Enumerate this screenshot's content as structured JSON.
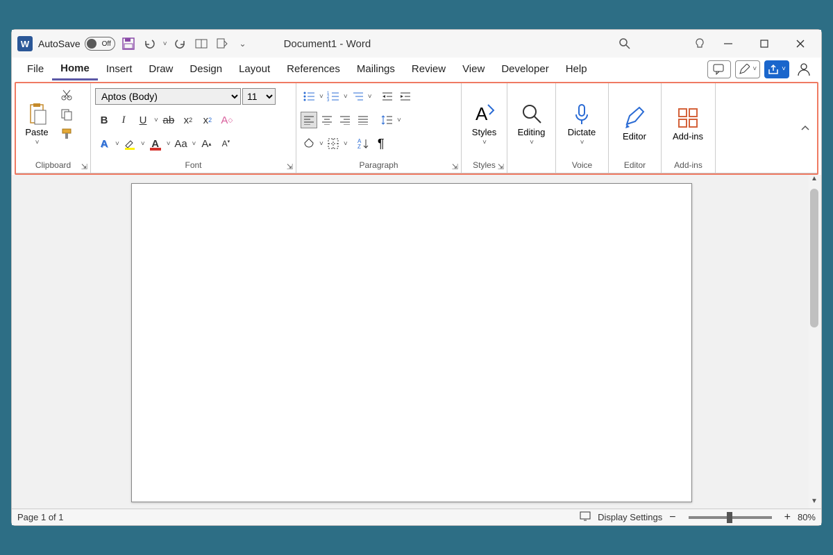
{
  "titlebar": {
    "autosave_label": "AutoSave",
    "autosave_state": "Off",
    "doc_title": "Document1  -  Word"
  },
  "tabs": {
    "items": [
      "File",
      "Home",
      "Insert",
      "Draw",
      "Design",
      "Layout",
      "References",
      "Mailings",
      "Review",
      "View",
      "Developer",
      "Help"
    ],
    "active": "Home"
  },
  "ribbon": {
    "clipboard": {
      "paste": "Paste",
      "label": "Clipboard"
    },
    "font": {
      "label": "Font",
      "name": "Aptos (Body)",
      "size": "11"
    },
    "paragraph": {
      "label": "Paragraph"
    },
    "styles": {
      "btn": "Styles",
      "label": "Styles"
    },
    "editing": {
      "btn": "Editing"
    },
    "voice": {
      "btn": "Dictate",
      "label": "Voice"
    },
    "editor": {
      "btn": "Editor",
      "label": "Editor"
    },
    "addins": {
      "btn": "Add-ins",
      "label": "Add-ins"
    }
  },
  "status": {
    "page": "Page 1 of 1",
    "display": "Display Settings",
    "zoom": "80%"
  },
  "colors": {
    "accent": "#2b5797",
    "tab_underline": "#5b57a6",
    "highlight_box": "#ef7a62",
    "share_btn": "#1a66cc"
  }
}
